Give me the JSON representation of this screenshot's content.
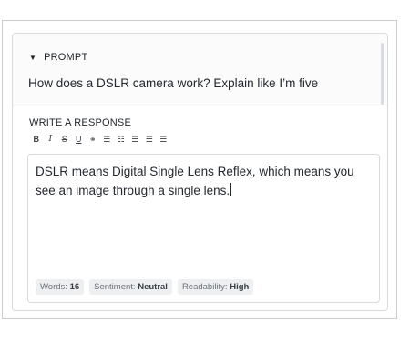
{
  "prompt": {
    "header": "PROMPT",
    "text": "How does a DSLR camera work? Explain like I’m five"
  },
  "response": {
    "label": "WRITE A RESPONSE",
    "toolbar": [
      {
        "name": "bold-button",
        "glyph": "B",
        "icon": "bold-icon"
      },
      {
        "name": "italic-button",
        "glyph": "I",
        "icon": "italic-icon"
      },
      {
        "name": "strikethrough-button",
        "glyph": "S",
        "icon": "strikethrough-icon"
      },
      {
        "name": "underline-button",
        "glyph": "U",
        "icon": "underline-icon"
      },
      {
        "name": "link-button",
        "glyph": "⚭",
        "icon": "link-icon"
      },
      {
        "name": "bulleted-list-button",
        "glyph": "☰",
        "icon": "bulleted-list-icon"
      },
      {
        "name": "numbered-list-button",
        "glyph": "☷",
        "icon": "numbered-list-icon"
      },
      {
        "name": "align-left-button",
        "glyph": "☰",
        "icon": "align-left-icon"
      },
      {
        "name": "align-center-button",
        "glyph": "☰",
        "icon": "align-center-icon"
      },
      {
        "name": "align-right-button",
        "glyph": "☰",
        "icon": "align-right-icon"
      }
    ],
    "text": "DSLR means Digital Single Lens Reflex, which means you see an image through a single lens."
  },
  "stats": {
    "words_label": "Words:",
    "words_value": "16",
    "sentiment_label": "Sentiment:",
    "sentiment_value": "Neutral",
    "readability_label": "Readability:",
    "readability_value": "High"
  }
}
